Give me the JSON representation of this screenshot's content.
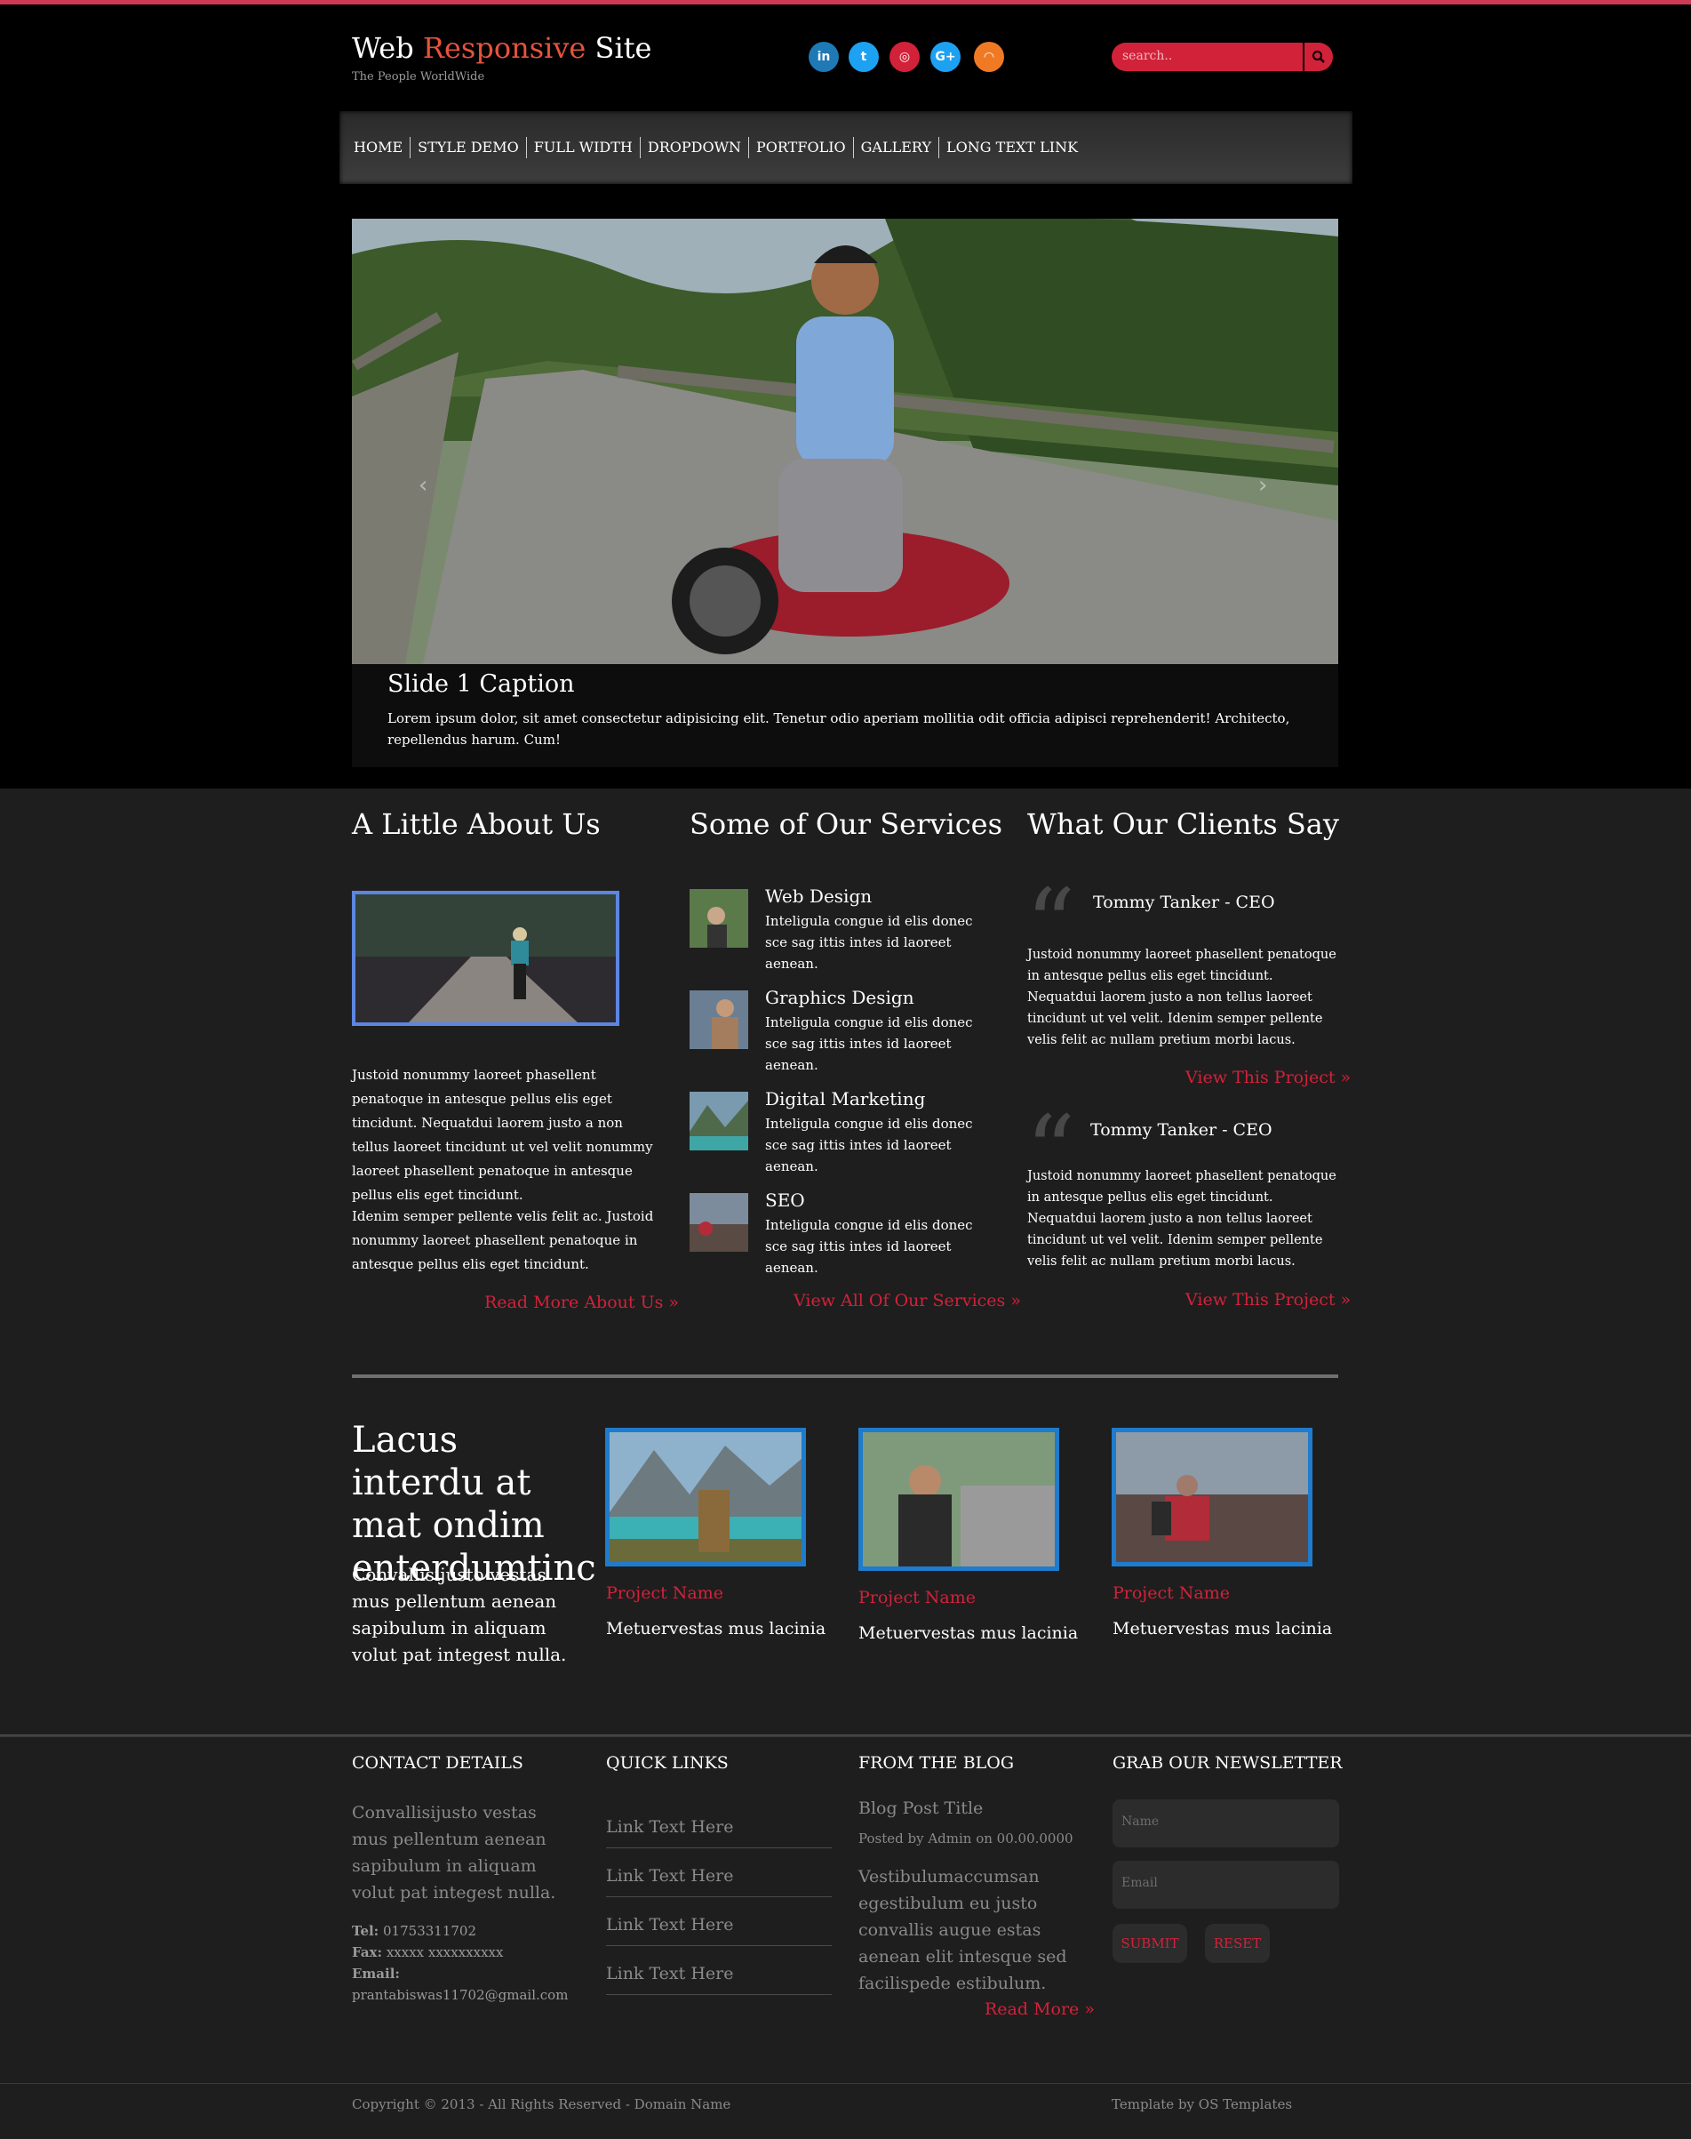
{
  "header": {
    "logo_part1": "Web ",
    "logo_part2": "Responsive",
    "logo_part3": " Site",
    "tagline": "The People WorldWide",
    "social": [
      {
        "name": "linkedin-icon",
        "glyph": "in",
        "color": "#1e79b5"
      },
      {
        "name": "twitter-icon",
        "glyph": "t",
        "color": "#1da1f2"
      },
      {
        "name": "pinterest-icon",
        "glyph": "◎",
        "color": "#d1223a"
      },
      {
        "name": "google-plus-icon",
        "glyph": "G+",
        "color": "#1da1f2"
      },
      {
        "name": "rss-icon",
        "glyph": "◠",
        "color": "#f07a24"
      }
    ],
    "search_placeholder": "search..",
    "accent_color": "#d1223a"
  },
  "nav": {
    "items": [
      "HOME",
      "STYLE DEMO",
      "FULL WIDTH",
      "DROPDOWN",
      "PORTFOLIO",
      "GALLERY",
      "LONG TEXT LINK"
    ]
  },
  "slider": {
    "caption_title": "Slide 1 Caption",
    "caption_text": "Lorem ipsum dolor, sit amet consectetur adipisicing elit. Tenetur odio aperiam mollitia odit officia adipisci reprehenderit! Architecto, repellendus harum. Cum!",
    "prev_glyph": "‹",
    "next_glyph": "›"
  },
  "about": {
    "heading": "A Little About Us",
    "p1": "Justoid nonummy laoreet phasellent penatoque in antesque pellus elis eget tincidunt. Nequatdui laorem justo a non tellus laoreet tincidunt ut vel velit nonummy laoreet phasellent penatoque in antesque pellus elis eget tincidunt.",
    "p2": "Idenim semper pellente velis felit ac. Justoid nonummy laoreet phasellent penatoque in antesque pellus elis eget tincidunt.",
    "link": "Read More About Us »"
  },
  "services": {
    "heading": "Some of Our Services",
    "items": [
      {
        "title": "Web Design",
        "text": "Inteligula congue id elis donec sce sag ittis intes id laoreet aenean."
      },
      {
        "title": "Graphics Design",
        "text": "Inteligula congue id elis donec sce sag ittis intes id laoreet aenean."
      },
      {
        "title": "Digital Marketing",
        "text": "Inteligula congue id elis donec sce sag ittis intes id laoreet aenean."
      },
      {
        "title": "SEO",
        "text": "Inteligula congue id elis donec sce sag ittis intes id laoreet aenean."
      }
    ],
    "link": "View All Of Our Services »"
  },
  "clients": {
    "heading": "What Our Clients Say",
    "quote_glyph": "“",
    "items": [
      {
        "name": "Tommy Tanker - CEO",
        "text": "Justoid nonummy laoreet phasellent penatoque in antesque pellus elis eget tincidunt. Nequatdui laorem justo a non tellus laoreet tincidunt ut vel velit. Idenim semper pellente velis felit ac nullam pretium morbi lacus.",
        "link": "View This Project »"
      },
      {
        "name": "Tommy Tanker - CEO",
        "text": "Justoid nonummy laoreet phasellent penatoque in antesque pellus elis eget tincidunt. Nequatdui laorem justo a non tellus laoreet tincidunt ut vel velit. Idenim semper pellente velis felit ac nullam pretium morbi lacus.",
        "link": "View This Project »"
      }
    ]
  },
  "projects": {
    "heading": "Lacus interdu at mat ondim enterdumtinc",
    "text": "Convallisijusto vestas mus pellentum aenean sapibulum in aliquam volut pat integest nulla.",
    "items": [
      {
        "name": "Project Name",
        "desc": "Metuervestas mus lacinia"
      },
      {
        "name": "Project Name",
        "desc": "Metuervestas mus lacinia"
      },
      {
        "name": "Project Name",
        "desc": "Metuervestas mus lacinia"
      }
    ]
  },
  "footer": {
    "contact": {
      "heading": "CONTACT DETAILS",
      "text": "Convallisijusto vestas mus pellentum aenean sapibulum in aliquam volut pat integest nulla.",
      "tel_label": "Tel:",
      "tel": "01753311702",
      "fax_label": "Fax:",
      "fax": "xxxxx xxxxxxxxxx",
      "email_label": "Email:",
      "email": "prantabiswas11702@gmail.com"
    },
    "quick_links": {
      "heading": "QUICK LINKS",
      "items": [
        "Link Text Here",
        "Link Text Here",
        "Link Text Here",
        "Link Text Here"
      ]
    },
    "blog": {
      "heading": "FROM THE BLOG",
      "post_title": "Blog Post Title",
      "meta": "Posted by Admin on 00.00.0000",
      "text": "Vestibulumaccumsan egestibulum eu justo convallis augue estas aenean elit intesque sed facilispede estibulum.",
      "link": "Read More »"
    },
    "newsletter": {
      "heading": "GRAB OUR NEWSLETTER",
      "name_placeholder": "Name",
      "email_placeholder": "Email",
      "submit": "SUBMIT",
      "reset": "RESET"
    },
    "copyright": "Copyright © 2013 - All Rights Reserved - Domain Name",
    "credit": "Template by OS Templates"
  }
}
